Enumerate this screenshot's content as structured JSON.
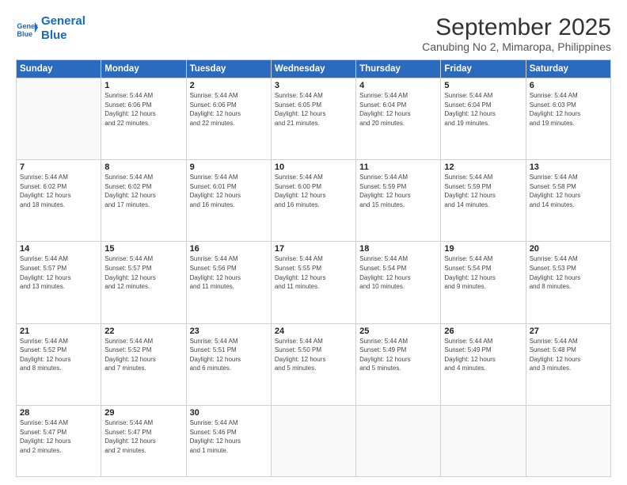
{
  "header": {
    "logo_line1": "General",
    "logo_line2": "Blue",
    "month": "September 2025",
    "location": "Canubing No 2, Mimaropa, Philippines"
  },
  "weekdays": [
    "Sunday",
    "Monday",
    "Tuesday",
    "Wednesday",
    "Thursday",
    "Friday",
    "Saturday"
  ],
  "weeks": [
    [
      {
        "day": "",
        "info": ""
      },
      {
        "day": "1",
        "info": "Sunrise: 5:44 AM\nSunset: 6:06 PM\nDaylight: 12 hours\nand 22 minutes."
      },
      {
        "day": "2",
        "info": "Sunrise: 5:44 AM\nSunset: 6:06 PM\nDaylight: 12 hours\nand 22 minutes."
      },
      {
        "day": "3",
        "info": "Sunrise: 5:44 AM\nSunset: 6:05 PM\nDaylight: 12 hours\nand 21 minutes."
      },
      {
        "day": "4",
        "info": "Sunrise: 5:44 AM\nSunset: 6:04 PM\nDaylight: 12 hours\nand 20 minutes."
      },
      {
        "day": "5",
        "info": "Sunrise: 5:44 AM\nSunset: 6:04 PM\nDaylight: 12 hours\nand 19 minutes."
      },
      {
        "day": "6",
        "info": "Sunrise: 5:44 AM\nSunset: 6:03 PM\nDaylight: 12 hours\nand 19 minutes."
      }
    ],
    [
      {
        "day": "7",
        "info": "Sunrise: 5:44 AM\nSunset: 6:02 PM\nDaylight: 12 hours\nand 18 minutes."
      },
      {
        "day": "8",
        "info": "Sunrise: 5:44 AM\nSunset: 6:02 PM\nDaylight: 12 hours\nand 17 minutes."
      },
      {
        "day": "9",
        "info": "Sunrise: 5:44 AM\nSunset: 6:01 PM\nDaylight: 12 hours\nand 16 minutes."
      },
      {
        "day": "10",
        "info": "Sunrise: 5:44 AM\nSunset: 6:00 PM\nDaylight: 12 hours\nand 16 minutes."
      },
      {
        "day": "11",
        "info": "Sunrise: 5:44 AM\nSunset: 5:59 PM\nDaylight: 12 hours\nand 15 minutes."
      },
      {
        "day": "12",
        "info": "Sunrise: 5:44 AM\nSunset: 5:59 PM\nDaylight: 12 hours\nand 14 minutes."
      },
      {
        "day": "13",
        "info": "Sunrise: 5:44 AM\nSunset: 5:58 PM\nDaylight: 12 hours\nand 14 minutes."
      }
    ],
    [
      {
        "day": "14",
        "info": "Sunrise: 5:44 AM\nSunset: 5:57 PM\nDaylight: 12 hours\nand 13 minutes."
      },
      {
        "day": "15",
        "info": "Sunrise: 5:44 AM\nSunset: 5:57 PM\nDaylight: 12 hours\nand 12 minutes."
      },
      {
        "day": "16",
        "info": "Sunrise: 5:44 AM\nSunset: 5:56 PM\nDaylight: 12 hours\nand 11 minutes."
      },
      {
        "day": "17",
        "info": "Sunrise: 5:44 AM\nSunset: 5:55 PM\nDaylight: 12 hours\nand 11 minutes."
      },
      {
        "day": "18",
        "info": "Sunrise: 5:44 AM\nSunset: 5:54 PM\nDaylight: 12 hours\nand 10 minutes."
      },
      {
        "day": "19",
        "info": "Sunrise: 5:44 AM\nSunset: 5:54 PM\nDaylight: 12 hours\nand 9 minutes."
      },
      {
        "day": "20",
        "info": "Sunrise: 5:44 AM\nSunset: 5:53 PM\nDaylight: 12 hours\nand 8 minutes."
      }
    ],
    [
      {
        "day": "21",
        "info": "Sunrise: 5:44 AM\nSunset: 5:52 PM\nDaylight: 12 hours\nand 8 minutes."
      },
      {
        "day": "22",
        "info": "Sunrise: 5:44 AM\nSunset: 5:52 PM\nDaylight: 12 hours\nand 7 minutes."
      },
      {
        "day": "23",
        "info": "Sunrise: 5:44 AM\nSunset: 5:51 PM\nDaylight: 12 hours\nand 6 minutes."
      },
      {
        "day": "24",
        "info": "Sunrise: 5:44 AM\nSunset: 5:50 PM\nDaylight: 12 hours\nand 5 minutes."
      },
      {
        "day": "25",
        "info": "Sunrise: 5:44 AM\nSunset: 5:49 PM\nDaylight: 12 hours\nand 5 minutes."
      },
      {
        "day": "26",
        "info": "Sunrise: 5:44 AM\nSunset: 5:49 PM\nDaylight: 12 hours\nand 4 minutes."
      },
      {
        "day": "27",
        "info": "Sunrise: 5:44 AM\nSunset: 5:48 PM\nDaylight: 12 hours\nand 3 minutes."
      }
    ],
    [
      {
        "day": "28",
        "info": "Sunrise: 5:44 AM\nSunset: 5:47 PM\nDaylight: 12 hours\nand 2 minutes."
      },
      {
        "day": "29",
        "info": "Sunrise: 5:44 AM\nSunset: 5:47 PM\nDaylight: 12 hours\nand 2 minutes."
      },
      {
        "day": "30",
        "info": "Sunrise: 5:44 AM\nSunset: 5:46 PM\nDaylight: 12 hours\nand 1 minute."
      },
      {
        "day": "",
        "info": ""
      },
      {
        "day": "",
        "info": ""
      },
      {
        "day": "",
        "info": ""
      },
      {
        "day": "",
        "info": ""
      }
    ]
  ]
}
